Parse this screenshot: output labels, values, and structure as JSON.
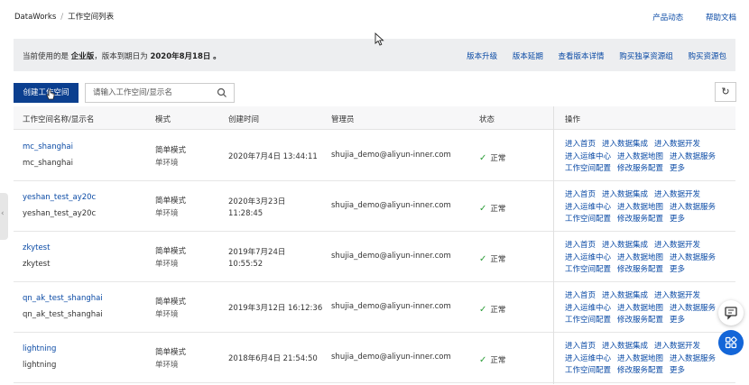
{
  "breadcrumb": {
    "root": "DataWorks",
    "sep": "/",
    "current": "工作空间列表"
  },
  "toplinks": {
    "product_news": "产品动态",
    "help": "帮助文档"
  },
  "notice": {
    "prefix": "当前使用的是",
    "edition": "企业版",
    "middle": "，版本到期日为",
    "date": "2020年8月18日",
    "suffix": "。",
    "links": [
      "版本升级",
      "版本延期",
      "查看版本详情",
      "购买独享资源组",
      "购买资源包"
    ]
  },
  "toolbar": {
    "create_label": "创建工作空间",
    "search_placeholder": "请输入工作空间/显示名",
    "refresh_icon": "refresh-icon"
  },
  "columns": {
    "name": "工作空间名称/显示名",
    "mode": "模式",
    "created": "创建时间",
    "admin": "管理员",
    "status": "状态",
    "ops": "操作"
  },
  "ops_labels": [
    "进入首页",
    "进入数据集成",
    "进入数据开发",
    "进入运维中心",
    "进入数据地图",
    "进入数据服务",
    "工作空间配置",
    "修改服务配置",
    "更多"
  ],
  "rows": [
    {
      "name": "mc_shanghai",
      "display": "mc_shanghai",
      "mode": "简单模式",
      "env": "单环境",
      "created_a": "2020年7月4日 13:44:11",
      "created_b": "",
      "admin": "shujia_demo@aliyun-inner.com",
      "status": "正常"
    },
    {
      "name": "yeshan_test_ay20c",
      "display": "yeshan_test_ay20c",
      "mode": "简单模式",
      "env": "单环境",
      "created_a": "2020年3月23日",
      "created_b": "11:28:45",
      "admin": "shujia_demo@aliyun-inner.com",
      "status": "正常"
    },
    {
      "name": "zkytest",
      "display": "zkytest",
      "mode": "简单模式",
      "env": "单环境",
      "created_a": "2019年7月24日",
      "created_b": "10:55:52",
      "admin": "shujia_demo@aliyun-inner.com",
      "status": "正常"
    },
    {
      "name": "qn_ak_test_shanghai",
      "display": "qn_ak_test_shanghai",
      "mode": "简单模式",
      "env": "单环境",
      "created_a": "2019年3月12日 16:12:36",
      "created_b": "",
      "admin": "shujia_demo@aliyun-inner.com",
      "status": "正常"
    },
    {
      "name": "lightning",
      "display": "lightning",
      "mode": "简单模式",
      "env": "单环境",
      "created_a": "2018年6月4日 21:54:50",
      "created_b": "",
      "admin": "shujia_demo@aliyun-inner.com",
      "status": "正常"
    }
  ],
  "status_icon": "check-icon",
  "colors": {
    "primary": "#0b3f8f",
    "link": "#0a4aa5",
    "success": "#2e9e3a",
    "float_button": "#1466d8"
  }
}
